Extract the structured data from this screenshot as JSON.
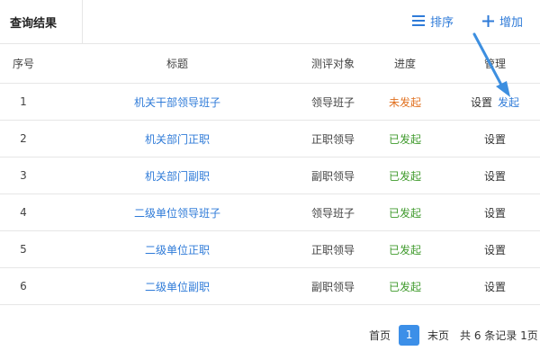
{
  "header": {
    "tab_label": "查询结果",
    "sort_label": "排序",
    "add_label": "增加",
    "accent_color": "#2f7bd8"
  },
  "table": {
    "columns": {
      "index": "序号",
      "title": "标题",
      "target": "测评对象",
      "progress": "进度",
      "manage": "管理"
    },
    "rows": [
      {
        "index": "1",
        "title": "机关干部领导班子",
        "target": "领导班子",
        "progress": "未发起",
        "progress_state": "pending",
        "setting": "设置",
        "launch": "发起"
      },
      {
        "index": "2",
        "title": "机关部门正职",
        "target": "正职领导",
        "progress": "已发起",
        "progress_state": "started",
        "setting": "设置"
      },
      {
        "index": "3",
        "title": "机关部门副职",
        "target": "副职领导",
        "progress": "已发起",
        "progress_state": "started",
        "setting": "设置"
      },
      {
        "index": "4",
        "title": "二级单位领导班子",
        "target": "领导班子",
        "progress": "已发起",
        "progress_state": "started",
        "setting": "设置"
      },
      {
        "index": "5",
        "title": "二级单位正职",
        "target": "正职领导",
        "progress": "已发起",
        "progress_state": "started",
        "setting": "设置"
      },
      {
        "index": "6",
        "title": "二级单位副职",
        "target": "副职领导",
        "progress": "已发起",
        "progress_state": "started",
        "setting": "设置"
      }
    ],
    "status_colors": {
      "pending": "#e0701f",
      "started": "#3f9a2c"
    }
  },
  "pagination": {
    "first": "首页",
    "current": "1",
    "last": "末页",
    "summary": "共 6 条记录 1页"
  }
}
